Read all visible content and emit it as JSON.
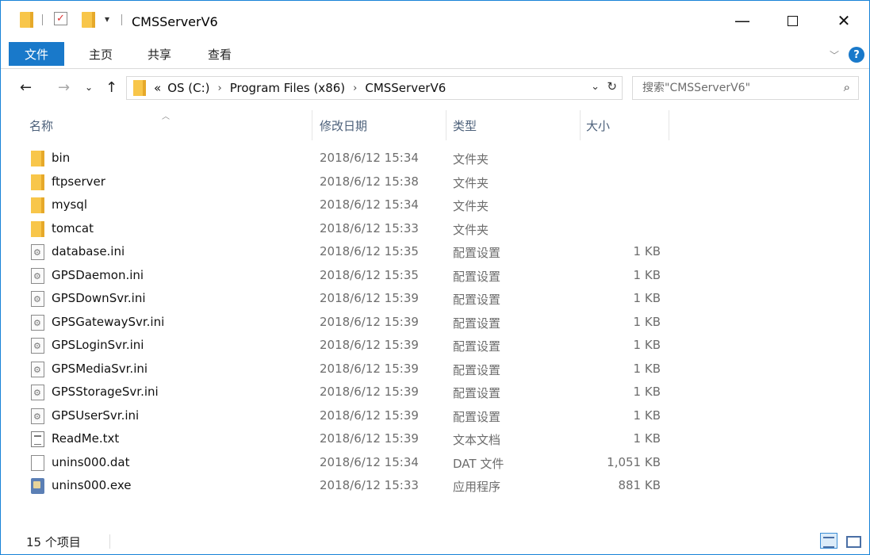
{
  "window": {
    "title": "CMSServerV6"
  },
  "ribbon": {
    "tabs": [
      {
        "label": "文件",
        "active": true
      },
      {
        "label": "主页"
      },
      {
        "label": "共享"
      },
      {
        "label": "查看"
      }
    ]
  },
  "address": {
    "overflow": "«",
    "crumbs": [
      "OS (C:)",
      "Program Files (x86)",
      "CMSServerV6"
    ]
  },
  "search": {
    "placeholder": "搜索\"CMSServerV6\""
  },
  "columns": {
    "name": "名称",
    "date": "修改日期",
    "type": "类型",
    "size": "大小"
  },
  "files": [
    {
      "name": "bin",
      "date": "2018/6/12 15:34",
      "type": "文件夹",
      "size": "",
      "icon": "folder-icon"
    },
    {
      "name": "ftpserver",
      "date": "2018/6/12 15:38",
      "type": "文件夹",
      "size": "",
      "icon": "folder-icon"
    },
    {
      "name": "mysql",
      "date": "2018/6/12 15:34",
      "type": "文件夹",
      "size": "",
      "icon": "folder-icon"
    },
    {
      "name": "tomcat",
      "date": "2018/6/12 15:33",
      "type": "文件夹",
      "size": "",
      "icon": "folder-icon"
    },
    {
      "name": "database.ini",
      "date": "2018/6/12 15:35",
      "type": "配置设置",
      "size": "1 KB",
      "icon": "ini-file-icon"
    },
    {
      "name": "GPSDaemon.ini",
      "date": "2018/6/12 15:35",
      "type": "配置设置",
      "size": "1 KB",
      "icon": "ini-file-icon"
    },
    {
      "name": "GPSDownSvr.ini",
      "date": "2018/6/12 15:39",
      "type": "配置设置",
      "size": "1 KB",
      "icon": "ini-file-icon"
    },
    {
      "name": "GPSGatewaySvr.ini",
      "date": "2018/6/12 15:39",
      "type": "配置设置",
      "size": "1 KB",
      "icon": "ini-file-icon"
    },
    {
      "name": "GPSLoginSvr.ini",
      "date": "2018/6/12 15:39",
      "type": "配置设置",
      "size": "1 KB",
      "icon": "ini-file-icon"
    },
    {
      "name": "GPSMediaSvr.ini",
      "date": "2018/6/12 15:39",
      "type": "配置设置",
      "size": "1 KB",
      "icon": "ini-file-icon"
    },
    {
      "name": "GPSStorageSvr.ini",
      "date": "2018/6/12 15:39",
      "type": "配置设置",
      "size": "1 KB",
      "icon": "ini-file-icon"
    },
    {
      "name": "GPSUserSvr.ini",
      "date": "2018/6/12 15:39",
      "type": "配置设置",
      "size": "1 KB",
      "icon": "ini-file-icon"
    },
    {
      "name": "ReadMe.txt",
      "date": "2018/6/12 15:39",
      "type": "文本文档",
      "size": "1 KB",
      "icon": "text-file-icon"
    },
    {
      "name": "unins000.dat",
      "date": "2018/6/12 15:34",
      "type": "DAT 文件",
      "size": "1,051 KB",
      "icon": "dat-file-icon"
    },
    {
      "name": "unins000.exe",
      "date": "2018/6/12 15:33",
      "type": "应用程序",
      "size": "881 KB",
      "icon": "exe-file-icon"
    }
  ],
  "status": {
    "count": "15 个项目"
  },
  "colors": {
    "accent": "#1979ca",
    "folder": "#f8c64a",
    "header_text": "#4c607a"
  }
}
